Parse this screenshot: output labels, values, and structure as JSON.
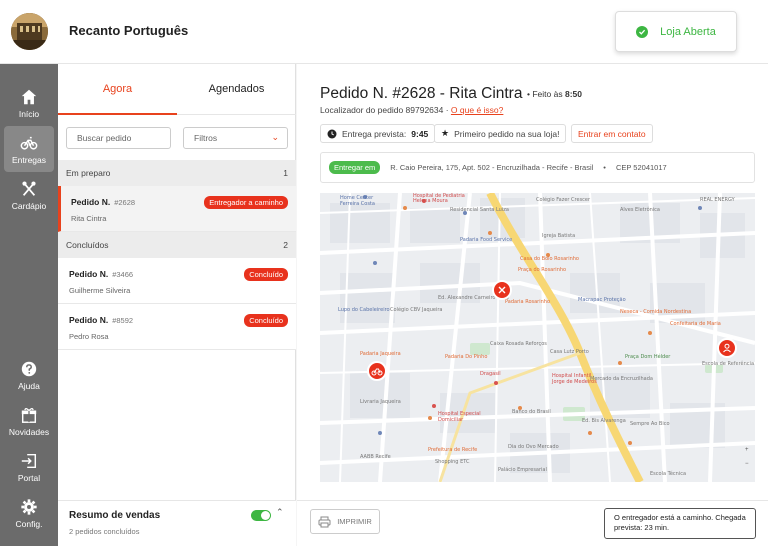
{
  "header": {
    "store_name": "Recanto Português",
    "status_label": "Loja Aberta",
    "colors": {
      "accent": "#e8421d",
      "status_open": "#3db642"
    }
  },
  "sidebar": {
    "items": [
      {
        "label": "Início",
        "icon": "home-icon"
      },
      {
        "label": "Entregas",
        "icon": "bike-icon",
        "active": true
      },
      {
        "label": "Cardápio",
        "icon": "utensils-icon"
      },
      {
        "label": "Ajuda",
        "icon": "help-icon"
      },
      {
        "label": "Novidades",
        "icon": "gift-icon"
      },
      {
        "label": "Portal",
        "icon": "portal-icon"
      },
      {
        "label": "Config.",
        "icon": "gear-icon"
      }
    ]
  },
  "orders": {
    "tabs": [
      {
        "label": "Agora",
        "active": true
      },
      {
        "label": "Agendados"
      }
    ],
    "search_placeholder": "Buscar pedido",
    "filter_label": "Filtros",
    "sections": [
      {
        "title": "Em preparo",
        "count": "1",
        "items": [
          {
            "title": "Pedido N.",
            "number": "#2628",
            "customer": "Rita Cintra",
            "badge": "Entregador a caminho"
          }
        ]
      },
      {
        "title": "Concluídos",
        "count": "2",
        "items": [
          {
            "title": "Pedido N.",
            "number": "#3466",
            "customer": "Guilherme Silveira",
            "badge": "Concluído"
          },
          {
            "title": "Pedido N.",
            "number": "#8592",
            "customer": "Pedro Rosa",
            "badge": "Concluído"
          }
        ]
      }
    ],
    "summary": {
      "title": "Resumo de vendas",
      "subtitle": "2 pedidos concluídos",
      "toggle_on": true
    }
  },
  "detail": {
    "title": "Pedido N. #2628 - Rita Cintra",
    "done_label": "Feito às",
    "done_time": "8:50",
    "locator_label": "Localizador do pedido 89792634",
    "locator_link": "O que é isso?",
    "eta_label": "Entrega prevista:",
    "eta_time": "9:45",
    "first_order": "Primeiro pedido na sua loja!",
    "contact": "Entrar em contato",
    "address_tag": "Entregar em",
    "address": "R. Caio Pereira, 175, Apt. 502 - Encruzilhada - Recife - Brasil",
    "cep": "CEP 52041017",
    "print": "IMPRIMIR",
    "courier_status": "O entregador está a caminho. Chegada prevista: 23 min."
  },
  "map": {
    "labels": [
      "Home Center Ferreira Costa",
      "Hospital de Pediatria Helena Moura",
      "Residencial Santa Luiza",
      "Colégio Fazer Crescer",
      "Alves Eletrônica",
      "Padaria Food Service",
      "Igreja Batista Praça de Campo Grande",
      "Casa do Bolo Rosarinho",
      "Praça do Rosarinho",
      "Ed. Alexandre Carneiro Leão",
      "Lupo do Cabeleireiro",
      "Colégio CBV Jaqueira",
      "Padaria Rosarinho",
      "Macrapac Proteção e Segurança",
      "Neseca - Comida Nordestina",
      "Caixa Rosada Reforços",
      "Casa Lutz Porto",
      "Padaria Jaqueira",
      "Padaria Do Pinho",
      "Dragasil",
      "Hospital Infantil Jorge de Medeiros",
      "Praça Dom Hélder",
      "Escola de Referência em Ensino Médio Nóbrega",
      "Hospital Especial Domiciliar",
      "Lavra Jaqueira",
      "Banco do Brasil",
      "Dia do Ovo Mercado",
      "Ed. Bis Alvarenga",
      "Sempre Ao Bico",
      "Shopping ETC",
      "Palácio Empresarial",
      "Prefeitura de Recife",
      "Escola Técnica",
      "REAL ENERGY",
      "Portal",
      "Encruzilhada"
    ]
  }
}
